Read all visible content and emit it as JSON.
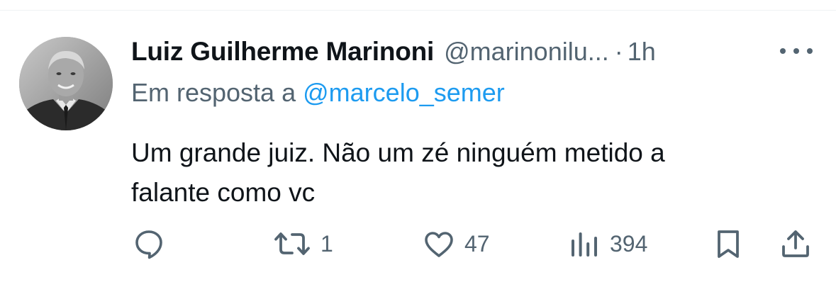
{
  "tweet": {
    "author": {
      "display_name": "Luiz Guilherme Marinoni",
      "handle": "@marinonilu...",
      "avatar": "avatar"
    },
    "separator": "·",
    "time": "1h",
    "reply_to": {
      "prefix": "Em resposta a",
      "mention": "@marcelo_semer"
    },
    "text_lines": [
      "Um grande juiz. Não um zé ninguém metido a",
      "falante como vc"
    ],
    "metrics": {
      "replies": "",
      "retweets": "1",
      "likes": "47",
      "views": "394"
    }
  },
  "icons": {
    "more": "more-icon",
    "reply": "reply-icon",
    "retweet": "retweet-icon",
    "like": "heart-icon",
    "views": "views-icon",
    "bookmark": "bookmark-icon",
    "share": "share-icon"
  },
  "colors": {
    "text": "#0f1419",
    "secondary": "#536471",
    "link": "#1d9bf0",
    "divider": "#eff3f4"
  }
}
